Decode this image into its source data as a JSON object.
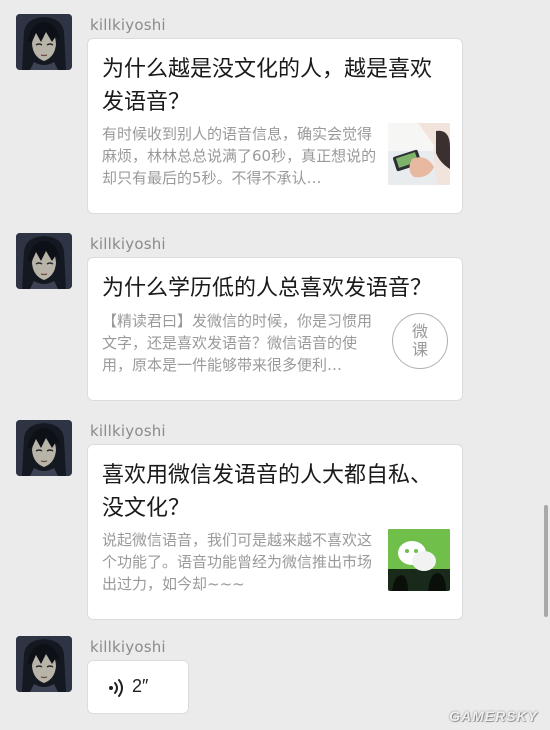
{
  "messages": [
    {
      "sender": "killkiyoshi",
      "title": "为什么越是没文化的人，越是喜欢发语音？",
      "desc": "有时候收到别人的语音信息，确实会觉得麻烦，林林总总说满了60秒，真正想说的却只有最后的5秒。不得不承认…",
      "thumb_icon": "phone-photo-icon"
    },
    {
      "sender": "killkiyoshi",
      "title": "为什么学历低的人总喜欢发语音？",
      "desc": "【精读君曰】发微信的时候，你是习惯用文字，还是喜欢发语音？微信语音的使用，原本是一件能够带来很多便利…",
      "thumb_badge": "微\n课"
    },
    {
      "sender": "killkiyoshi",
      "title": "喜欢用微信发语音的人大都自私、没文化？",
      "desc": "说起微信语音，我们可是越来越不喜欢这个功能了。语音功能曾经为微信推出市场出过力，如今却~~~",
      "thumb_icon": "wechat-logo-icon"
    },
    {
      "sender": "killkiyoshi",
      "voice_duration": "2″",
      "voice_icon": "voice-wave-icon"
    }
  ],
  "watermark": "GAMERSKY",
  "colors": {
    "background": "#ebebeb",
    "card": "#ffffff",
    "sender": "#8b8b8b",
    "title": "#1a1a1a",
    "desc": "#9a9a9a"
  }
}
